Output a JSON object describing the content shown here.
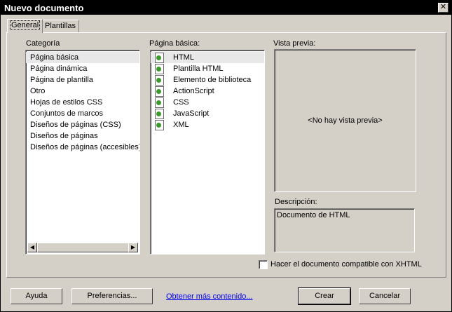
{
  "window": {
    "title": "Nuevo documento",
    "close_glyph": "✕"
  },
  "tabs": [
    {
      "label": "General",
      "active": true
    },
    {
      "label": "Plantillas",
      "active": false
    }
  ],
  "categories": {
    "label": "Categoría",
    "items": [
      "Página básica",
      "Página dinámica",
      "Página de plantilla",
      "Otro",
      "Hojas de estilos CSS",
      "Conjuntos de marcos",
      "Diseños de páginas (CSS)",
      "Diseños de páginas",
      "Diseños de páginas (accesibles)"
    ],
    "selected": 0
  },
  "basic_page": {
    "label": "Página básica:",
    "items": [
      "HTML",
      "Plantilla HTML",
      "Elemento de biblioteca",
      "ActionScript",
      "CSS",
      "JavaScript",
      "XML"
    ],
    "selected": 0,
    "icon": "document-icon"
  },
  "preview": {
    "label": "Vista previa:",
    "placeholder": "<No hay vista previa>"
  },
  "description": {
    "label": "Descripción:",
    "text": "Documento de HTML"
  },
  "xhtml": {
    "label": "Hacer el documento compatible con XHTML",
    "checked": false
  },
  "buttons": {
    "help": "Ayuda",
    "preferences": "Preferencias...",
    "more_content": "Obtener más contenido...",
    "create": "Crear",
    "cancel": "Cancelar"
  }
}
